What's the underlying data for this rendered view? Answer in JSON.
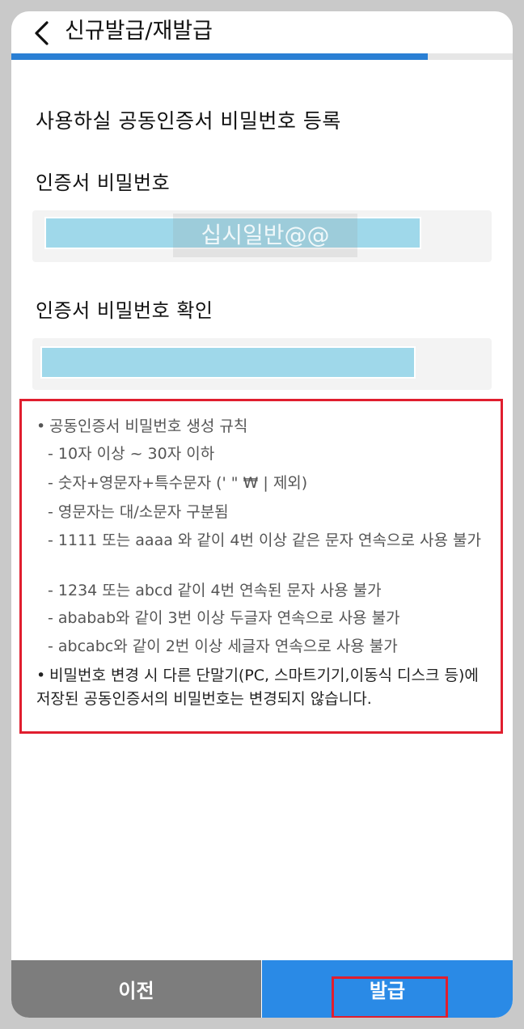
{
  "header": {
    "title": "신규발급/재발급",
    "back_icon": "chevron-left-icon"
  },
  "progress": {
    "value": 0.83,
    "color": "#2a7fd4"
  },
  "page": {
    "section_title": "사용하실 공동인증서 비밀번호 등록"
  },
  "fields": {
    "password_label": "인증서 비밀번호",
    "password_watermark": "십시일반@@",
    "confirm_label": "인증서 비밀번호 확인"
  },
  "rules": {
    "heading": "공동인증서 비밀번호 생성 규칙",
    "items": [
      "- 10자 이상 ~ 30자 이하",
      "- 숫자+영문자+특수문자 (' \" ₩ | 제외)",
      "- 영문자는 대/소문자 구분됨",
      "- 1111 또는 aaaa 와 같이 4번 이상 같은 문자 연속으로 사용 불가",
      "- 1234 또는 abcd 같이 4번 연속된 문자 사용 불가",
      "- ababab와 같이 3번 이상 두글자 연속으로 사용 불가",
      "- abcabc와 같이 2번 이상 세글자 연속으로 사용 불가"
    ],
    "notice": "비밀번호 변경 시 다른 단말기(PC, 스마트기기,이동식 디스크 등)에 저장된 공동인증서의 비밀번호는 변경되지 않습니다."
  },
  "buttons": {
    "prev_label": "이전",
    "issue_label": "발급"
  },
  "colors": {
    "accent": "#2a8ae6",
    "highlight": "#e01e2e",
    "field_fill": "#9fd8ea"
  }
}
